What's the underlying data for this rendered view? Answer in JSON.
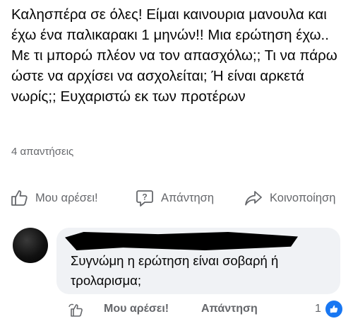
{
  "post": {
    "text": "Καλησπέρα σε όλες! Είμαι καινουρια μανουλα και έχω ένα παλικαρακι 1 μηνών!! Μια ερώτηση έχω.. Με τι μπορώ πλέον να τον απασχόλω;; Τι να πάρω ώστε να αρχίσει να ασχολείται; Ή είναι αρκετά νωρίς;; Ευχαριστώ εκ των προτέρων",
    "replies_count": "4 απαντήσεις"
  },
  "actions": {
    "like_label": "Μου αρέσει!",
    "reply_label": "Απάντηση",
    "share_label": "Κοινοποίηση"
  },
  "comment": {
    "text": "Συγνώμη η ερώτηση είναι σοβαρή ή τρολαρισμα;",
    "like_label": "Μου αρέσει!",
    "reply_label": "Απάντηση",
    "like_count": "1"
  },
  "colors": {
    "accent": "#1877f2",
    "muted_text": "#65676b",
    "bubble": "#f0f2f5"
  },
  "icons": [
    "thumbs-up-icon",
    "comment-question-icon",
    "share-arrow-icon",
    "reaction-icon",
    "like-badge-icon"
  ]
}
